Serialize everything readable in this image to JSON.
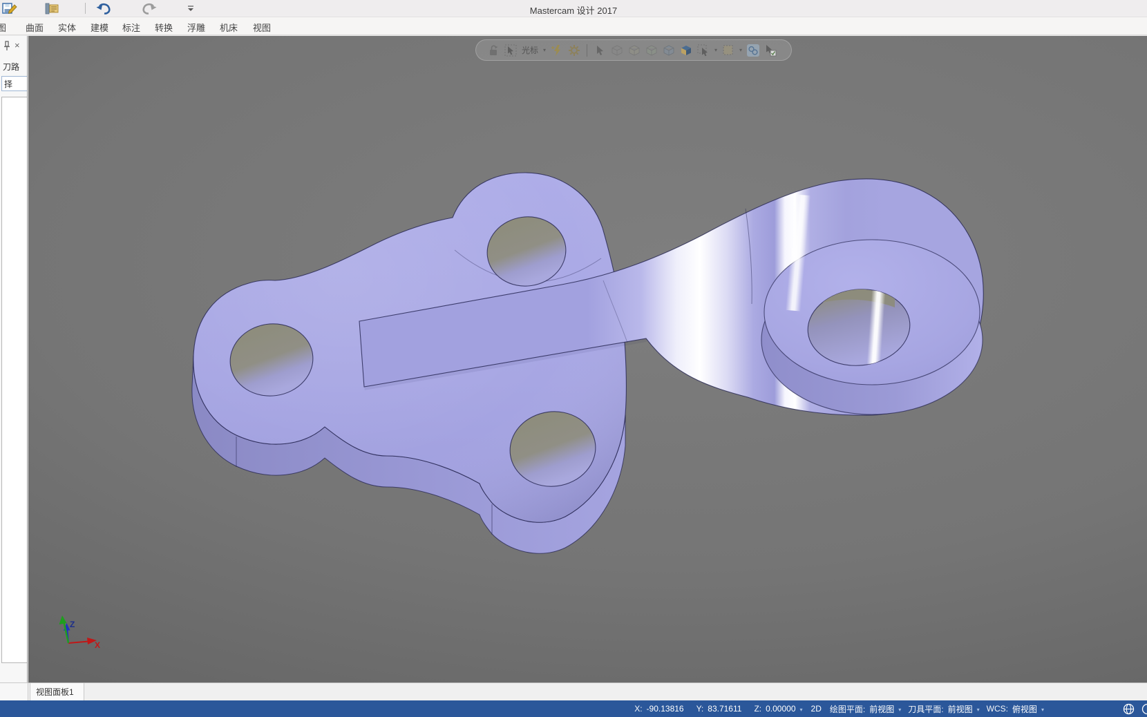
{
  "window": {
    "title": "Mastercam 设计 2017"
  },
  "quick_access": {
    "icons": [
      "save-icon",
      "file-properties-icon",
      "undo-icon",
      "redo-icon",
      "customize-chevron-icon"
    ]
  },
  "ribbon_tabs": [
    "图",
    "曲面",
    "实体",
    "建模",
    "标注",
    "转换",
    "浮雕",
    "机床",
    "视图"
  ],
  "toolpaths_panel": {
    "icons": [
      "pin-icon",
      "close-icon"
    ],
    "close_glyph": "×",
    "title": "刀路",
    "filter_value": "择"
  },
  "selection_bar": {
    "cursor_label": "光标",
    "caret_glyph": "▾",
    "icons": [
      "unlock-icon",
      "cursor-mode-icon",
      "autocursor-bolt-icon",
      "gear-icon",
      "select-arrow-icon",
      "select-window-icon",
      "select-polygon-icon",
      "select-vector-icon",
      "select-solid-icon",
      "select-face-cube-icon",
      "select-all-icon",
      "select-only-icon",
      "feature-select-icon",
      "validate-select-icon"
    ]
  },
  "viewport": {
    "view_tab": "视图面板1",
    "axis_x_label": "X",
    "axis_z_label": "Z"
  },
  "status_bar": {
    "x_label": "X:",
    "x_value": "-90.13816",
    "y_label": "Y:",
    "y_value": "83.71611",
    "z_label": "Z:",
    "z_value": "0.00000",
    "mode": "2D",
    "cplane_label": "绘图平面:",
    "cplane_value": "前视图",
    "tplane_label": "刀具平面:",
    "tplane_value": "前视图",
    "wcs_label": "WCS:",
    "wcs_value": "俯视图",
    "icons": [
      "globe-icon",
      "partial-circle-icon"
    ]
  },
  "colors": {
    "status_bar_blue": "#2b579a",
    "part_lavender": "#a7a6e3",
    "part_side": "#9594d2",
    "hole_interior_olive": "#8d8c7a",
    "highlight_white": "#ffffff",
    "viewport_gray": "#757575",
    "edge_navy": "#23234f"
  }
}
